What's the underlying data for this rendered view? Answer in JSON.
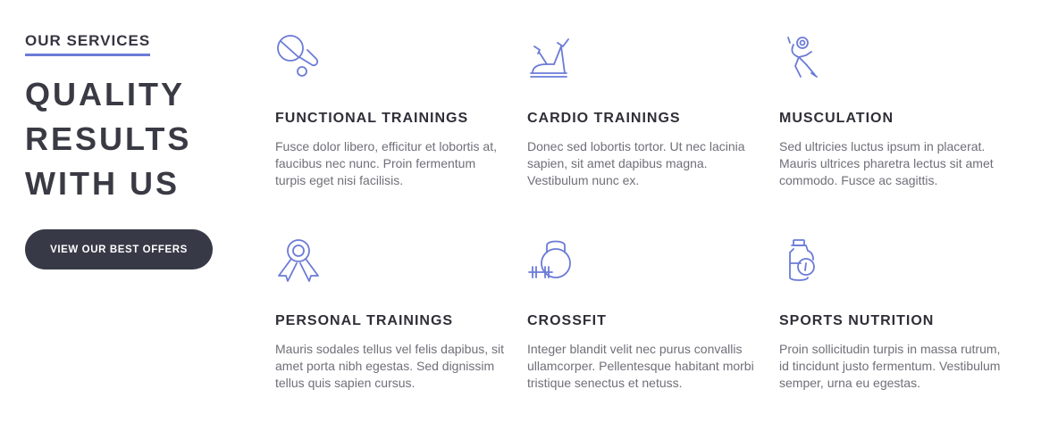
{
  "intro": {
    "eyebrow": "OUR SERVICES",
    "headline": [
      "QUALITY",
      "RESULTS",
      "WITH US"
    ],
    "cta_label": "VIEW OUR BEST OFFERS"
  },
  "services": [
    {
      "icon": "ping-pong-icon",
      "title": "FUNCTIONAL TRAININGS",
      "description": "Fusce dolor libero, efficitur et lobortis at, faucibus nec nunc. Proin fermentum turpis eget nisi facilisis."
    },
    {
      "icon": "exercise-bike-icon",
      "title": "CARDIO TRAININGS",
      "description": "Donec sed lobortis tortor. Ut nec lacinia sapien, sit amet dapibus magna. Vestibulum nunc ex."
    },
    {
      "icon": "weightlifter-icon",
      "title": "MUSCULATION",
      "description": "Sed ultricies luctus ipsum in placerat. Mauris ultrices pharetra lectus sit amet commodo. Fusce ac sagittis."
    },
    {
      "icon": "award-ribbon-icon",
      "title": "PERSONAL TRAININGS",
      "description": "Mauris sodales tellus vel felis dapibus, sit amet porta nibh egestas. Sed dignissim tellus quis sapien cursus."
    },
    {
      "icon": "kettlebell-icon",
      "title": "CROSSFIT",
      "description": "Integer blandit velit nec purus convallis ullamcorper. Pellentesque habitant morbi tristique senectus et netuss."
    },
    {
      "icon": "supplement-bottle-icon",
      "title": "SPORTS NUTRITION",
      "description": "Proin sollicitudin turpis in massa rutrum, id tincidunt justo fermentum. Vestibulum semper, urna eu egestas."
    }
  ],
  "colors": {
    "accent": "#6b7bd6",
    "button_bg": "#373a46",
    "heading": "#3a3a44",
    "body_text": "#6f6f78"
  }
}
